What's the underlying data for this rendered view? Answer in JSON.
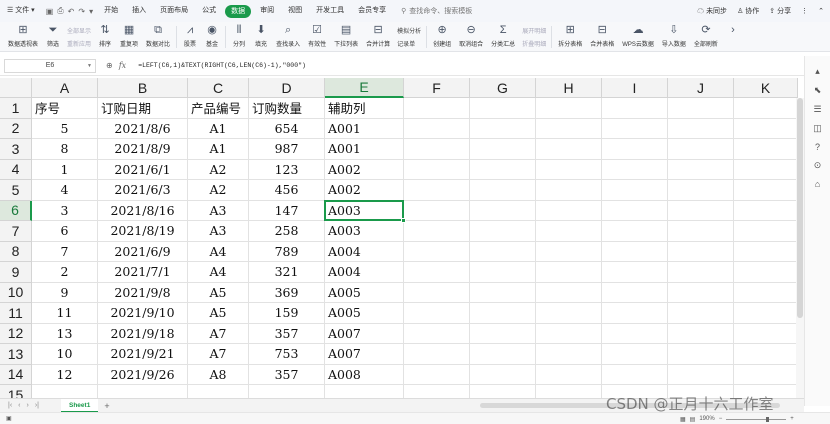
{
  "menubar": {
    "file": "文件",
    "tabs": [
      "开始",
      "插入",
      "页面布局",
      "公式",
      "数据",
      "审阅",
      "视图",
      "开发工具",
      "会员专享"
    ],
    "active_tab": "数据",
    "search_placeholder": "查找命令、搜索模板",
    "right": {
      "sync": "未同步",
      "collab": "协作",
      "share": "分享"
    }
  },
  "ribbon": {
    "pivot": "数据透视表",
    "filter": "筛选",
    "show_all": "全部显示",
    "reapply": "重新应用",
    "sort": "排序",
    "duplicates": "重复项",
    "compare": "数据对比",
    "stock": "股票",
    "fund": "基金",
    "split": "分列",
    "fill": "填充",
    "find_entry": "查找录入",
    "validity": "有效性",
    "dropdown": "下拉列表",
    "consolidate": "合并计算",
    "simulate": "模拟分析",
    "record": "记录单",
    "group": "创建组",
    "ungroup": "取消组合",
    "subtotal": "分类汇总",
    "expand": "展开明细",
    "collapse": "折叠明细",
    "split_table": "拆分表格",
    "merge_table": "合并表格",
    "wps_cloud": "WPS云数据",
    "import": "导入数据",
    "refresh_all": "全部刷新"
  },
  "formula_bar": {
    "name_box": "E6",
    "formula": "=LEFT(C6,1)&TEXT(RIGHT(C6,LEN(C6)-1),\"000\")"
  },
  "sheet": {
    "columns": [
      "A",
      "B",
      "C",
      "D",
      "E",
      "F",
      "G",
      "H",
      "I",
      "J",
      "K"
    ],
    "row_numbers": [
      "1",
      "2",
      "3",
      "4",
      "5",
      "6",
      "7",
      "8",
      "9",
      "10",
      "11",
      "12",
      "13",
      "14",
      "15"
    ],
    "selected_column": "E",
    "selected_row": "6",
    "header": [
      "序号",
      "订购日期",
      "产品编号",
      "订购数量",
      "辅助列"
    ],
    "rows": [
      [
        "5",
        "2021/8/6",
        "A1",
        "654",
        "A001"
      ],
      [
        "8",
        "2021/8/9",
        "A1",
        "987",
        "A001"
      ],
      [
        "1",
        "2021/6/1",
        "A2",
        "123",
        "A002"
      ],
      [
        "4",
        "2021/6/3",
        "A2",
        "456",
        "A002"
      ],
      [
        "3",
        "2021/8/16",
        "A3",
        "147",
        "A003"
      ],
      [
        "6",
        "2021/8/19",
        "A3",
        "258",
        "A003"
      ],
      [
        "7",
        "2021/6/9",
        "A4",
        "789",
        "A004"
      ],
      [
        "2",
        "2021/7/1",
        "A4",
        "321",
        "A004"
      ],
      [
        "9",
        "2021/9/8",
        "A5",
        "369",
        "A005"
      ],
      [
        "11",
        "2021/9/10",
        "A5",
        "159",
        "A005"
      ],
      [
        "13",
        "2021/9/18",
        "A7",
        "357",
        "A007"
      ],
      [
        "10",
        "2021/9/21",
        "A7",
        "753",
        "A007"
      ],
      [
        "12",
        "2021/9/26",
        "A8",
        "357",
        "A008"
      ]
    ]
  },
  "sheet_tabs": {
    "active": "Sheet1",
    "add": "+"
  },
  "status": {
    "zoom": "190%"
  },
  "watermark": "CSDN @正月十六工作室",
  "colors": {
    "accent": "#1a9a4b"
  }
}
